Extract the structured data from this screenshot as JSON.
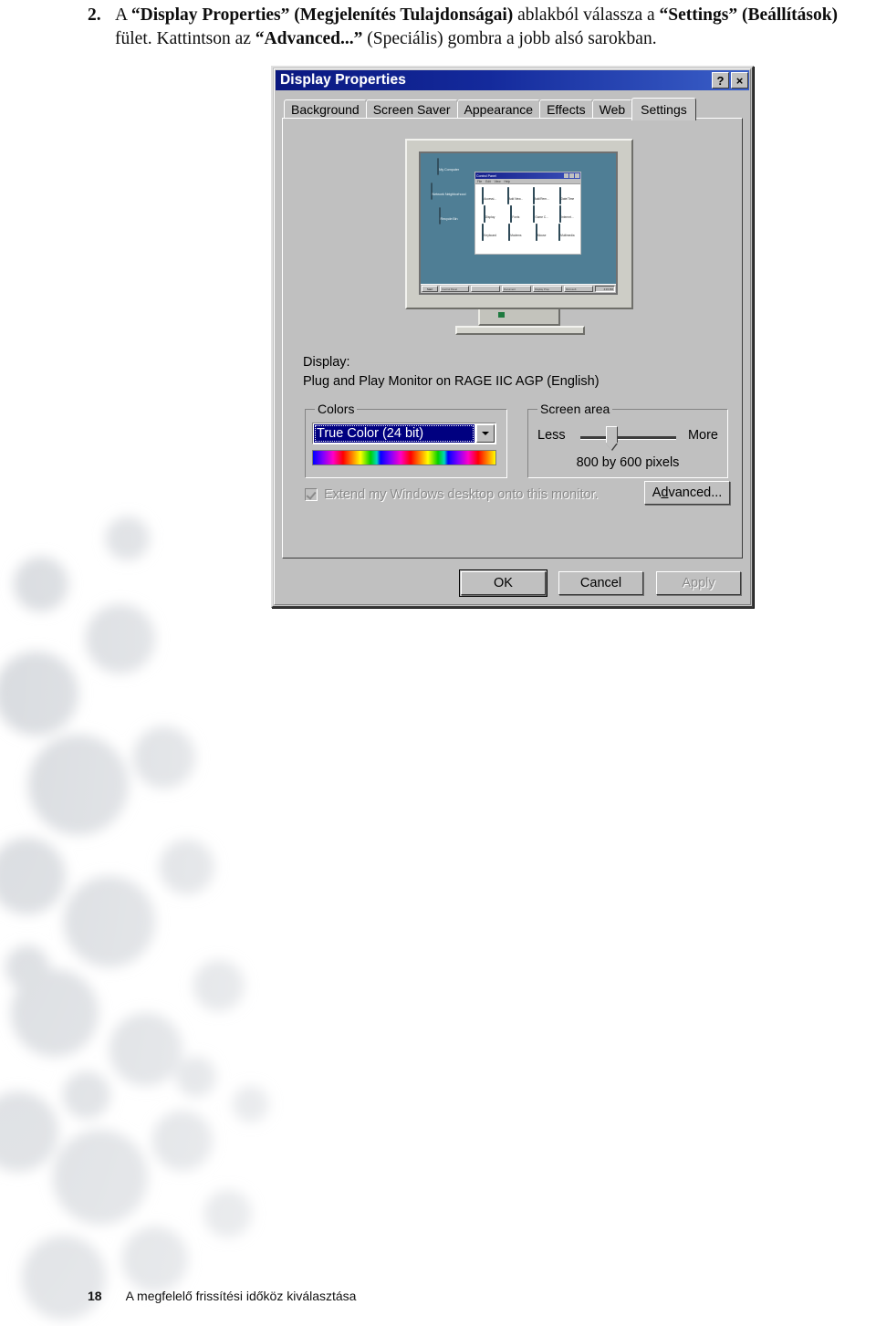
{
  "instruction": {
    "number": "2.",
    "segments": [
      {
        "text": "A ",
        "bold": false
      },
      {
        "text": "“Display Properties” (Megjelenítés Tulajdonságai)",
        "bold": true
      },
      {
        "text": " ablakból válassza a ",
        "bold": false
      },
      {
        "text": "“Settings” (Beállítások)",
        "bold": true
      },
      {
        "text": " fület. Kattintson az ",
        "bold": false
      },
      {
        "text": "“Advanced...”",
        "bold": true
      },
      {
        "text": " (Speciális) gombra a jobb alsó sarokban.",
        "bold": false
      }
    ]
  },
  "dialog": {
    "title": "Display Properties",
    "title_buttons": [
      {
        "name": "help",
        "glyph": "?"
      },
      {
        "name": "close",
        "glyph": "×"
      }
    ],
    "tabs": [
      {
        "label": "Background",
        "active": false
      },
      {
        "label": "Screen Saver",
        "active": false
      },
      {
        "label": "Appearance",
        "active": false
      },
      {
        "label": "Effects",
        "active": false
      },
      {
        "label": "Web",
        "active": false
      },
      {
        "label": "Settings",
        "active": true
      }
    ],
    "preview": {
      "desktop_icons": [
        {
          "label": "My Computer"
        },
        {
          "label": "Network Neighborhood"
        },
        {
          "label": "Recycle Bin"
        }
      ],
      "window": {
        "title": "Control Panel",
        "menus": [
          "File",
          "Edit",
          "View",
          "Help"
        ],
        "items": [
          {
            "label": "Accessi..."
          },
          {
            "label": "Add New..."
          },
          {
            "label": "Add/Rem..."
          },
          {
            "label": "Date/Time"
          },
          {
            "label": "Display"
          },
          {
            "label": "Fonts"
          },
          {
            "label": "Game C..."
          },
          {
            "label": "Internet..."
          },
          {
            "label": "Keyboard"
          },
          {
            "label": "Modems"
          },
          {
            "label": "Mouse"
          },
          {
            "label": "Multimedia"
          }
        ]
      },
      "taskbar": {
        "start_label": "Start",
        "tasks": [
          "Control Panel",
          "",
          "Document",
          "Display Prop",
          "Microsoft"
        ],
        "tray_label": "4:15 PM"
      }
    },
    "display": {
      "label": "Display:",
      "value": "Plug and Play Monitor on RAGE IIC AGP (English)"
    },
    "colors": {
      "caption": "Colors",
      "selected": "True Color (24 bit)"
    },
    "screen_area": {
      "caption": "Screen area",
      "less_label": "Less",
      "more_label": "More",
      "resolution": "800 by 600 pixels",
      "slider_percent": 30
    },
    "extend_checkbox": {
      "label": "Extend my Windows desktop onto this monitor.",
      "checked": true,
      "enabled": false
    },
    "advanced_button": {
      "prefix": "A",
      "accel": "d",
      "suffix": "vanced..."
    },
    "buttons": [
      {
        "label": "OK",
        "state": "default"
      },
      {
        "label": "Cancel",
        "state": "normal"
      },
      {
        "label": "Apply",
        "state": "disabled"
      }
    ]
  },
  "footer": {
    "page": "18",
    "text": "A megfelelő frissítési időköz kiválasztása"
  },
  "colors": {
    "titlebar_start": "#0a1880",
    "titlebar_end": "#3a5fc8",
    "dialog_face": "#c0c0c0",
    "selection_blue": "#000080",
    "preview_desktop": "#4f7e95"
  }
}
